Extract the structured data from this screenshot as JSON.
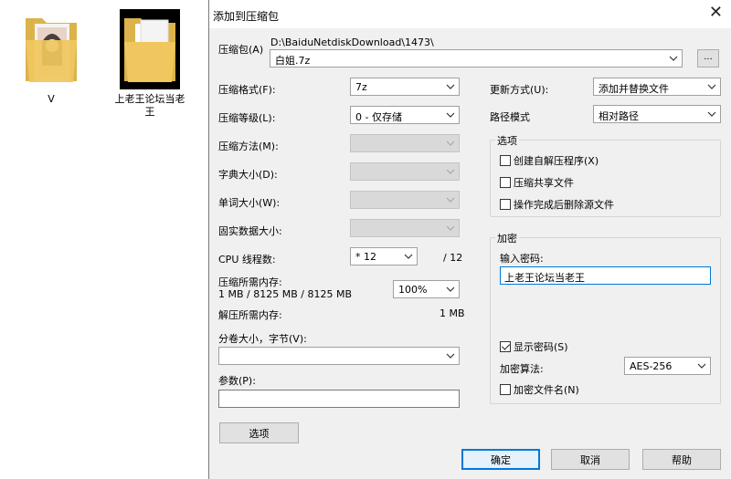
{
  "desktop": {
    "folder1_label": "V",
    "folder2_label": "上老王论坛当老王"
  },
  "dialog": {
    "title": "添加到压缩包",
    "archive_label": "压缩包(A)",
    "archive_path": "D:\\BaiduNetdiskDownload\\1473\\",
    "archive_name": "白姐.7z",
    "browse_label": "...",
    "format_label": "压缩格式(F):",
    "format_value": "7z",
    "level_label": "压缩等级(L):",
    "level_value": "0 - 仅存储",
    "method_label": "压缩方法(M):",
    "dict_label": "字典大小(D):",
    "word_label": "单词大小(W):",
    "solid_label": "固实数据大小:",
    "cpu_label": "CPU 线程数:",
    "cpu_value": "* 12",
    "cpu_total": "/ 12",
    "mem_comp_label": "压缩所需内存:",
    "mem_comp_value": "1 MB / 8125 MB / 8125 MB",
    "mem_percent": "100%",
    "mem_decomp_label": "解压所需内存:",
    "mem_decomp_value": "1 MB",
    "volume_label": "分卷大小，字节(V):",
    "volume_value": "",
    "params_label": "参数(P):",
    "params_value": "",
    "options_button": "选项",
    "update_label": "更新方式(U):",
    "update_value": "添加并替换文件",
    "path_label": "路径模式",
    "path_value": "相对路径",
    "options_group_title": "选项",
    "opt_sfx": "创建自解压程序(X)",
    "opt_shared": "压缩共享文件",
    "opt_delete": "操作完成后删除源文件",
    "encrypt_group_title": "加密",
    "password_label": "输入密码:",
    "password_value": "上老王论坛当老王",
    "show_password": "显示密码(S)",
    "algo_label": "加密算法:",
    "algo_value": "AES-256",
    "encrypt_names": "加密文件名(N)",
    "ok_button": "确定",
    "cancel_button": "取消",
    "help_button": "帮助"
  },
  "icons": [
    "folder-icon",
    "close-icon",
    "chevron-down-icon",
    "checkbox-icon"
  ],
  "colors": {
    "accent": "#0078d7",
    "dialog_bg": "#f0f0f0"
  }
}
